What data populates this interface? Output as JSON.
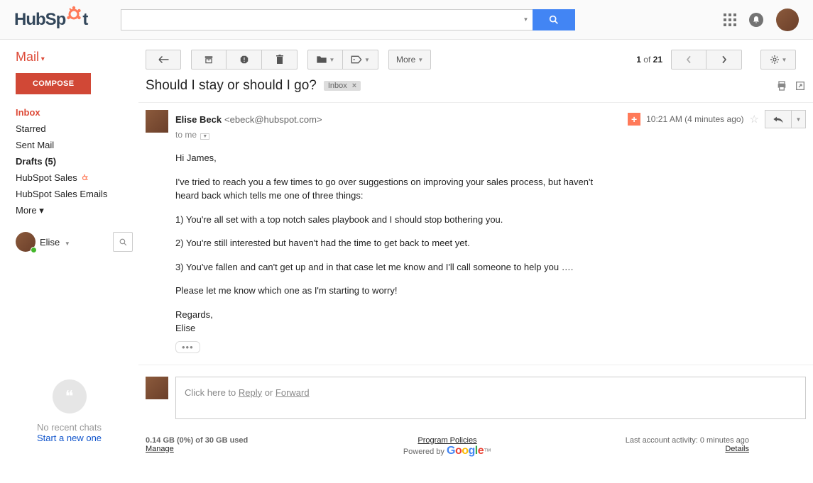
{
  "logo": {
    "text": "HubSpot"
  },
  "search": {
    "placeholder": ""
  },
  "sidebar": {
    "mail_label": "Mail",
    "compose": "COMPOSE",
    "items": [
      {
        "label": "Inbox",
        "active": true
      },
      {
        "label": "Starred"
      },
      {
        "label": "Sent Mail"
      },
      {
        "label": "Drafts (5)",
        "bold": true
      },
      {
        "label": "HubSpot Sales",
        "icon": true
      },
      {
        "label": "HubSpot Sales Emails"
      },
      {
        "label": "More ▾"
      }
    ],
    "chat_user": "Elise",
    "hangouts": {
      "line1": "No recent chats",
      "line2": "Start a new one"
    }
  },
  "toolbar": {
    "more_label": "More",
    "pagination_current": "1",
    "pagination_of": "of",
    "pagination_total": "21"
  },
  "message": {
    "subject": "Should I stay or should I go?",
    "label": "Inbox",
    "sender_name": "Elise Beck",
    "sender_email": "<ebeck@hubspot.com>",
    "recipient": "to me",
    "timestamp": "10:21 AM (4 minutes ago)",
    "body": {
      "greeting": "Hi James,",
      "p1": "I've tried to reach you a few times to go over suggestions on improving your sales process, but haven't heard back which tells me one of three things:",
      "p2": "1) You're all set with a top notch sales playbook and I should stop bothering you.",
      "p3": "2) You're still interested but haven't had the time to get back to meet yet.",
      "p4": "3) You've fallen and can't get up and in that case let me know and I'll call someone to help you ….",
      "p5": "Please let me know which one as I'm starting to worry!",
      "signoff": "Regards,",
      "signature": "Elise"
    }
  },
  "reply_box": {
    "prefix": "Click here to ",
    "reply": "Reply",
    "or": " or ",
    "forward": "Forward"
  },
  "footer": {
    "storage": "0.14 GB (0%) of 30 GB used",
    "manage": "Manage",
    "policies": "Program Policies",
    "powered": "Powered by ",
    "activity": "Last account activity: 0 minutes ago",
    "details": "Details"
  }
}
